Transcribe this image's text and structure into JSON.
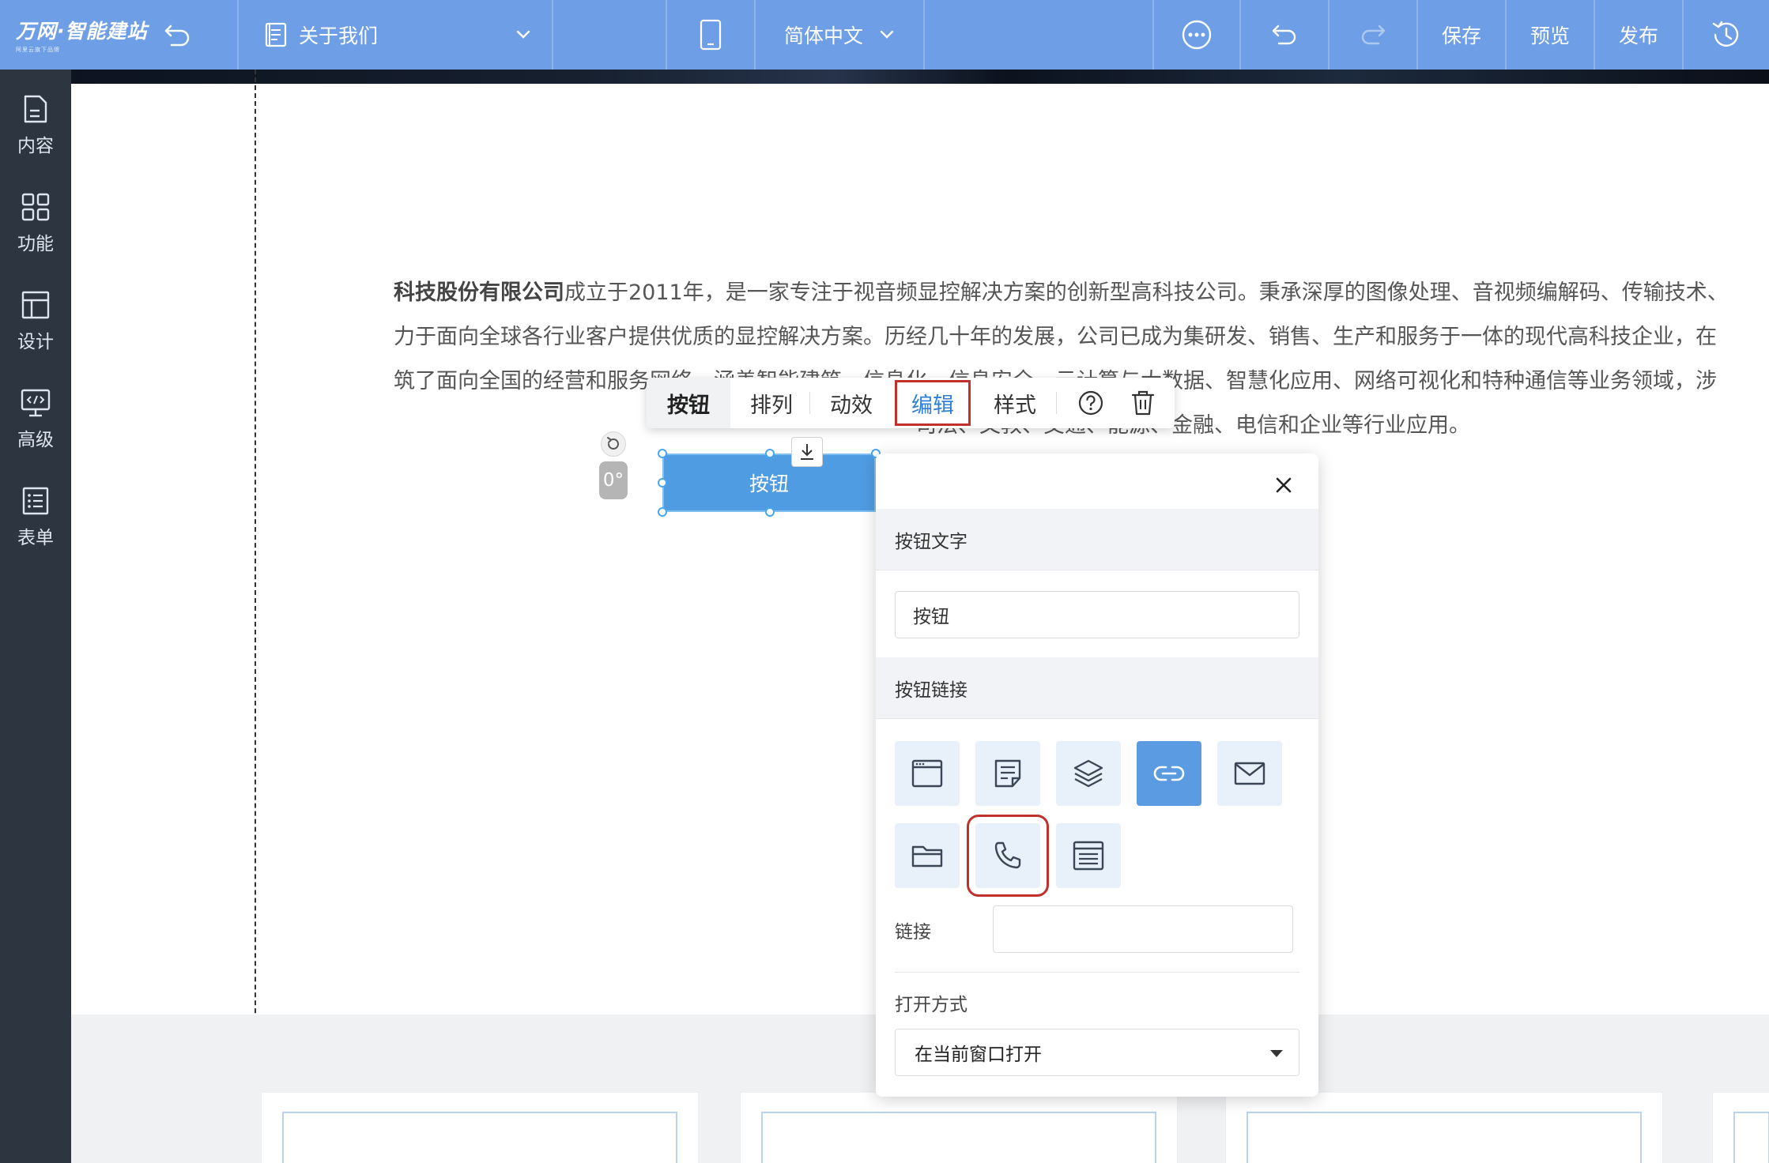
{
  "topbar": {
    "logo_text": "万网·智能建站",
    "logo_sub": "阿里云旗下品牌",
    "page_name": "关于我们",
    "language": "简体中文",
    "save": "保存",
    "preview": "预览",
    "publish": "发布"
  },
  "sidebar": {
    "items": [
      {
        "label": "内容",
        "icon": "content-icon"
      },
      {
        "label": "功能",
        "icon": "apps-grid-icon"
      },
      {
        "label": "设计",
        "icon": "layout-icon"
      },
      {
        "label": "高级",
        "icon": "code-monitor-icon"
      },
      {
        "label": "表单",
        "icon": "form-list-icon"
      }
    ]
  },
  "content": {
    "company_bold": "科技股份有限公司",
    "para_line1": "成立于2011年，是一家专注于视音频显控解决方案的创新型高科技公司。秉承深厚的图像处理、音视频编解码、传输技术、",
    "para_line2": "力于面向全球各行业客户提供优质的显控解决方案。历经几十年的发展，公司已成为集研发、销售、生产和服务于一体的现代高科技企业，在",
    "para_line3": "筑了面向全国的经营和服务网络，涵盖智能建筑、信息化、信息安全、云计算与大数据、智慧化应用、网络可视化和特种通信等业务领域，涉",
    "para_line4": "司法、文教、交通、能源、金融、电信和企业等行业应用。"
  },
  "float_toolbar": {
    "items": [
      "按钮",
      "排列",
      "动效",
      "编辑",
      "样式"
    ],
    "active": "按钮",
    "highlighted": "编辑"
  },
  "button_element": {
    "label": "按钮",
    "rotation": "0°"
  },
  "edit_panel": {
    "text_section": "按钮文字",
    "text_value": "按钮",
    "link_section": "按钮链接",
    "link_types": [
      {
        "icon": "webpage-icon",
        "selected": false
      },
      {
        "icon": "article-icon",
        "selected": false
      },
      {
        "icon": "layers-icon",
        "selected": false
      },
      {
        "icon": "link-icon",
        "selected": true
      },
      {
        "icon": "mail-icon",
        "selected": false
      },
      {
        "icon": "folder-icon",
        "selected": false
      },
      {
        "icon": "phone-icon",
        "selected": false,
        "highlighted": true
      },
      {
        "icon": "popup-window-icon",
        "selected": false
      }
    ],
    "link_label": "链接",
    "link_value": "",
    "open_mode_label": "打开方式",
    "open_mode_value": "在当前窗口打开"
  },
  "colors": {
    "topbar": "#6d9ee6",
    "sidebar": "#2d3540",
    "accent": "#4f9ce2",
    "highlight_box": "#c0312b"
  }
}
